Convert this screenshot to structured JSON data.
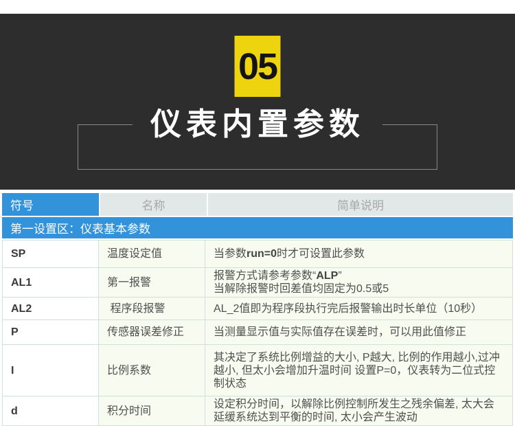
{
  "hero": {
    "badge_number": "05",
    "title": "仪表内置参数",
    "colors": {
      "background": "#2d2d2d",
      "badge_bg": "#eed40f",
      "badge_text": "#141414",
      "title_text": "#ffffff",
      "bracket_line": "#8a8a8a"
    }
  },
  "table": {
    "colors": {
      "accent_blue": "#3293da",
      "header_gray_bg": "#e2e7e7",
      "header_gray_text": "#a4a8a8",
      "body_green_bg": "#f8fcf0",
      "symbol_col_bg": "#ffffff",
      "border": "#cde0da",
      "symbol_text": "#3a3a3a",
      "body_text": "#4f4f4f"
    },
    "headers": [
      "符号",
      "名称",
      "简单说明"
    ],
    "section_title": "第一设置区：仪表基本参数",
    "rows": [
      {
        "symbol": "SP",
        "name": "温度设定值",
        "desc": {
          "pre": "当参数",
          "bold": "run=0",
          "post": "时才可设置此参数"
        }
      },
      {
        "symbol": "AL1",
        "name": "第一报警",
        "desc": {
          "line1_pre": "报警方式请参考参数“",
          "line1_bold": "ALP",
          "line1_post": "”",
          "line2": "当解除报警时回差值均固定为0.5或5"
        }
      },
      {
        "symbol": "AL2",
        "name": " 程序段报警",
        "desc": {
          "text": "AL_2值即为程序段执行完后报警输出时长单位（10秒）"
        }
      },
      {
        "symbol": "P",
        "name": "传感器误差修正",
        "desc": {
          "text": "当测量显示值与实际值存在误差时，可以用此值修正"
        }
      },
      {
        "symbol": "I",
        "name": "比例系数",
        "desc": {
          "text": "其决定了系统比例增益的大小, P越大, 比例的作用越小,过冲越小, 但太小会增加升温时间 设置P=0，仪表转为二位式控制状态"
        }
      },
      {
        "symbol": "d",
        "name": "积分时间",
        "desc": {
          "text": "设定积分时间，以解除比例控制所发生之残余偏差, 太大会延缓系统达到平衡的时间, 太小会产生波动"
        }
      }
    ]
  }
}
